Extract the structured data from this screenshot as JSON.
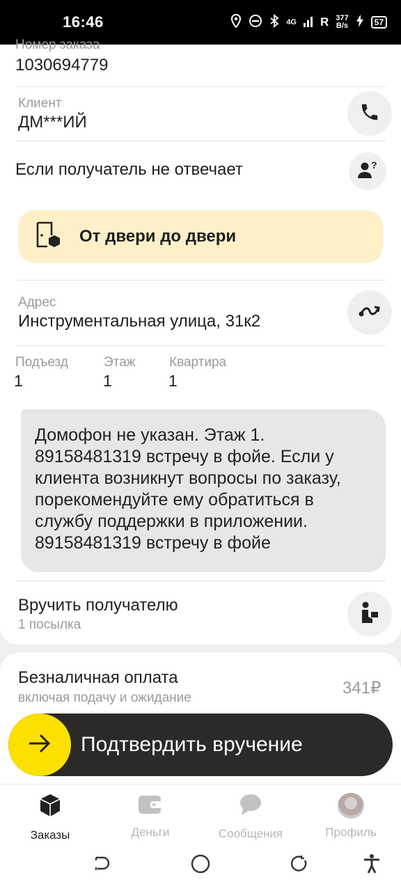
{
  "status": {
    "time": "16:46",
    "network": "4G",
    "roaming": "R",
    "speed_value": "377",
    "speed_unit": "B/s",
    "battery": "57"
  },
  "order": {
    "number_label": "Номер заказа",
    "number": "1030694779"
  },
  "client": {
    "label": "Клиент",
    "name": "ДМ***ИЙ"
  },
  "no_answer": {
    "label": "Если получатель не отвечает"
  },
  "delivery": {
    "type": "От двери до двери"
  },
  "address": {
    "label": "Адрес",
    "value": "Инструментальная улица, 31к2"
  },
  "details": [
    {
      "label": "Подъезд",
      "value": "1"
    },
    {
      "label": "Этаж",
      "value": "1"
    },
    {
      "label": "Квартира",
      "value": "1"
    }
  ],
  "comment": {
    "text": "Домофон не указан. Этаж 1. 89158481319 встречу в фойе. Если у клиента возникнут вопросы по заказу, порекомендуйте ему обратиться в службу поддержки в приложении. 89158481319 встречу в фойе"
  },
  "handover": {
    "title": "Вручить получателю",
    "subtitle": "1 посылка"
  },
  "payment": {
    "title": "Безналичная оплата",
    "subtitle": "включая подачу и ожидание",
    "amount": "341₽"
  },
  "confirm_button": {
    "label": "Подтвердить вручение"
  },
  "tabs": [
    {
      "label": "Заказы",
      "icon": "box-icon",
      "active": true
    },
    {
      "label": "Деньги",
      "icon": "wallet-icon",
      "active": false
    },
    {
      "label": "Сообщения",
      "icon": "chat-icon",
      "active": false
    },
    {
      "label": "Профиль",
      "icon": "avatar",
      "active": false
    }
  ],
  "colors": {
    "accent_yellow": "#fce000",
    "banner_yellow": "#fdf0c8",
    "dark_button": "#2b2a28"
  }
}
